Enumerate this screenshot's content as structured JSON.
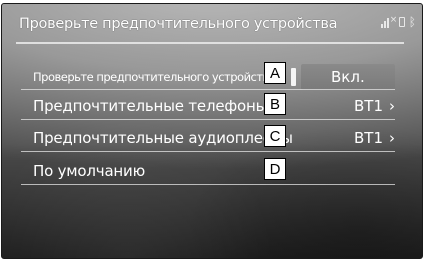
{
  "screen": {
    "title": "Проверьте предпочтительного устройства",
    "status_icons": [
      "signal-icon",
      "battery-icon",
      "bluetooth-icon"
    ]
  },
  "rows": [
    {
      "label": "Проверьте предпочтительного устройства",
      "value": "Вкл.",
      "callout": "A"
    },
    {
      "label": "Предпочтительные телефоны",
      "value": "BT1",
      "callout": "B"
    },
    {
      "label": "Предпочтительные аудиоплееры",
      "value": "BT1",
      "callout": "C"
    },
    {
      "label": "По умолчанию",
      "value": "",
      "callout": "D"
    }
  ],
  "chevron": "›"
}
